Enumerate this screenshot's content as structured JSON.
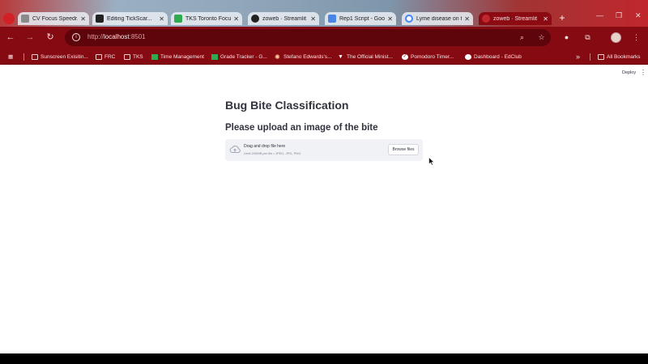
{
  "browser": {
    "tabs": [
      {
        "title": "CV Focus Speedr...",
        "favicon_color": "#8a8a8a",
        "active": false
      },
      {
        "title": "Editing TickScar...",
        "favicon_color": "#222222",
        "active": false
      },
      {
        "title": "TKS Toronto Focu...",
        "favicon_color": "#2eaa4f",
        "active": false
      },
      {
        "title": "zoweb · Streamlit",
        "favicon_color": "#222222",
        "active": false
      },
      {
        "title": "Rep1 Script - Goo...",
        "favicon_color": "#4a86e8",
        "active": false
      },
      {
        "title": "Lyme disease on t...",
        "favicon_color": "#4285f4",
        "active": false
      },
      {
        "title": "zoweb · Streamlit",
        "favicon_color": "#c0272d",
        "active": true
      }
    ],
    "new_tab_icon": "plus-icon",
    "url_host": "localhost",
    "url_prefix": "http://",
    "url_port": ":8501",
    "bookmarks": [
      {
        "label": "Sunscreen Exisitin...",
        "icon": "folder-icon"
      },
      {
        "label": "FRC",
        "icon": "folder-icon"
      },
      {
        "label": "TKS",
        "icon": "folder-icon"
      },
      {
        "label": "Time Management",
        "icon": "sheet-icon"
      },
      {
        "label": "Grade Tracker - G...",
        "icon": "sheet-icon"
      },
      {
        "label": "Stefano Edwards's...",
        "icon": "sun-icon"
      },
      {
        "label": "The Official Minist...",
        "icon": "triangle-icon"
      },
      {
        "label": "Pomodoro Timer...",
        "icon": "check-icon"
      },
      {
        "label": "Dashboard - EdClub",
        "icon": "edclub-icon"
      }
    ],
    "more_bookmarks": "»",
    "all_bookmarks": "All Bookmarks",
    "accent_color": "#860a12"
  },
  "app": {
    "deploy_label": "Deploy",
    "title": "Bug Bite Classification",
    "subtitle": "Please upload an image of the bite",
    "uploader": {
      "drop_text": "Drag and drop file here",
      "limit_text": "Limit 200MB per file • JPEG, JPG, PNG",
      "browse_label": "Browse files"
    }
  }
}
